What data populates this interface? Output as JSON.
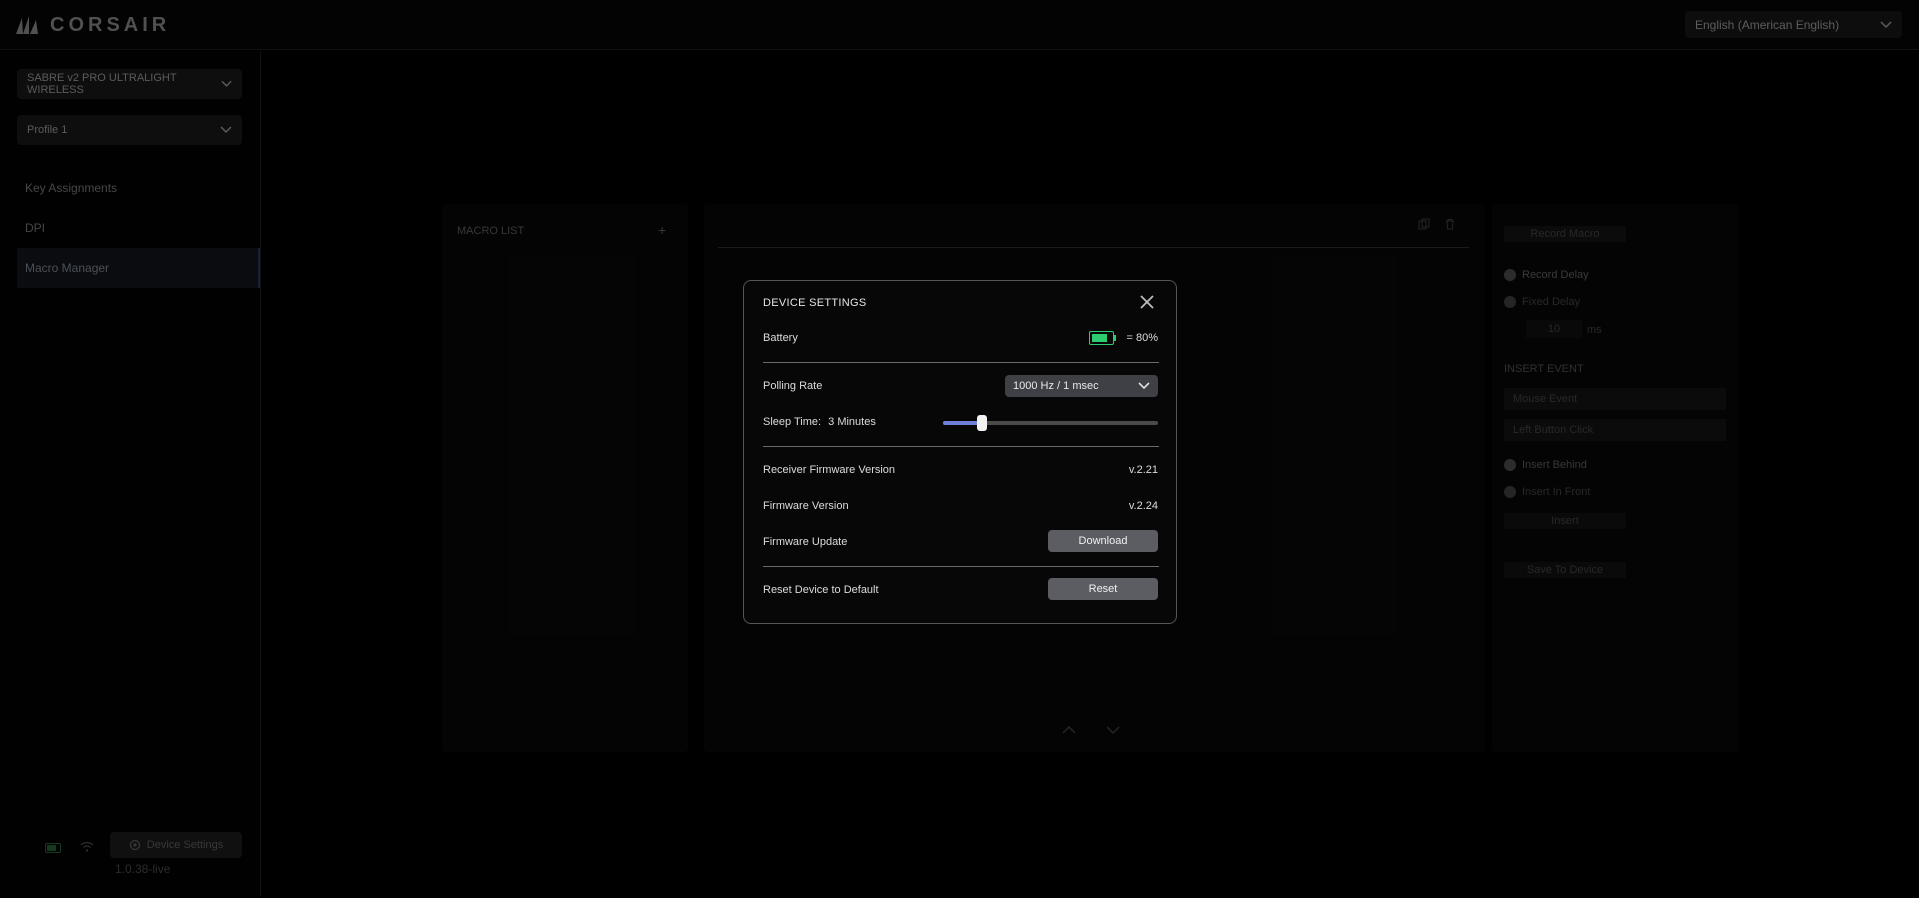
{
  "header": {
    "brand": "CORSAIR",
    "language": "English (American English)"
  },
  "sidebar": {
    "device": "SABRE v2 PRO ULTRALIGHT WIRELESS",
    "profile": "Profile 1",
    "nav": [
      {
        "label": "Key Assignments"
      },
      {
        "label": "DPI"
      },
      {
        "label": "Macro Manager"
      }
    ],
    "device_settings_label": "Device Settings",
    "version": "1.0.38-live"
  },
  "macro_list": {
    "title": "MACRO LIST",
    "add": "+"
  },
  "right_panel": {
    "record_macro": "Record Macro",
    "record_delay": "Record Delay",
    "fixed_delay": "Fixed Delay",
    "delay_value": "10",
    "delay_unit": "ms",
    "insert_event_title": "INSERT EVENT",
    "event_type": "Mouse Event",
    "event_action": "Left Button Click",
    "insert_behind": "Insert Behind",
    "insert_in_front": "Insert In Front",
    "insert": "Insert",
    "save_to_device": "Save To Device"
  },
  "modal": {
    "title": "DEVICE SETTINGS",
    "battery_label": "Battery",
    "battery_value": "= 80%",
    "battery_level": 0.8,
    "polling_label": "Polling Rate",
    "polling_value": "1000 Hz / 1 msec",
    "sleep_label": "Sleep Time:",
    "sleep_value": "3 Minutes",
    "sleep_fraction": 0.18,
    "receiver_fw_label": "Receiver Firmware Version",
    "receiver_fw_value": "v.2.21",
    "fw_label": "Firmware Version",
    "fw_value": "v.2.24",
    "fw_update_label": "Firmware Update",
    "download_label": "Download",
    "reset_label": "Reset Device to Default",
    "reset_button": "Reset"
  },
  "colors": {
    "accent": "#6f7fdc",
    "battery": "#2ecc71"
  }
}
